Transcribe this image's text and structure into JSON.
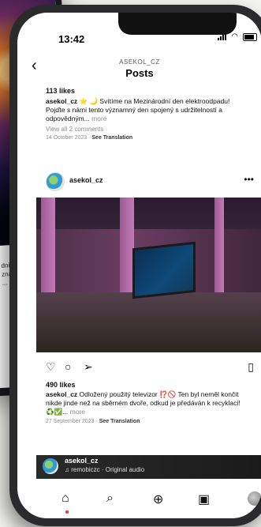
{
  "status_bar": {
    "time": "13:42"
  },
  "header": {
    "account": "ASEKOL_CZ",
    "title": "Posts"
  },
  "background_phone": {
    "snippet": "dní d\nznam\n... m"
  },
  "post1": {
    "likes": "113 likes",
    "username": "asekol_cz",
    "caption": "⭐ 🌙 Svítíme na Mezinárodní den elektroodpadu! Pojďte s námi tento významný den spojený s udržitelností a odpovědným...",
    "more": "more",
    "comments": "View all 2 comments",
    "date": "14 October 2023",
    "translation": "See Translation"
  },
  "post2": {
    "username": "asekol_cz",
    "likes": "490 likes",
    "caption_user": "asekol_cz",
    "caption": "Odložený použitý televizor ⁉️🚫 Ten byl neměl končit nikde jinde než na sběrném dvoře, odkud je předáván k recyklaci! ♻️✅...",
    "more": "more",
    "date": "27 September 2023",
    "translation": "See Translation"
  },
  "mini_player": {
    "username": "asekol_cz",
    "audio": "♫ remobiczc · Original audio"
  },
  "icons": {
    "back": "‹",
    "menu": "•••",
    "like": "♡",
    "comment": "○",
    "share": "➢",
    "save": "▯",
    "home": "⌂",
    "search": "⌕",
    "create": "⊕",
    "reels": "▣"
  }
}
